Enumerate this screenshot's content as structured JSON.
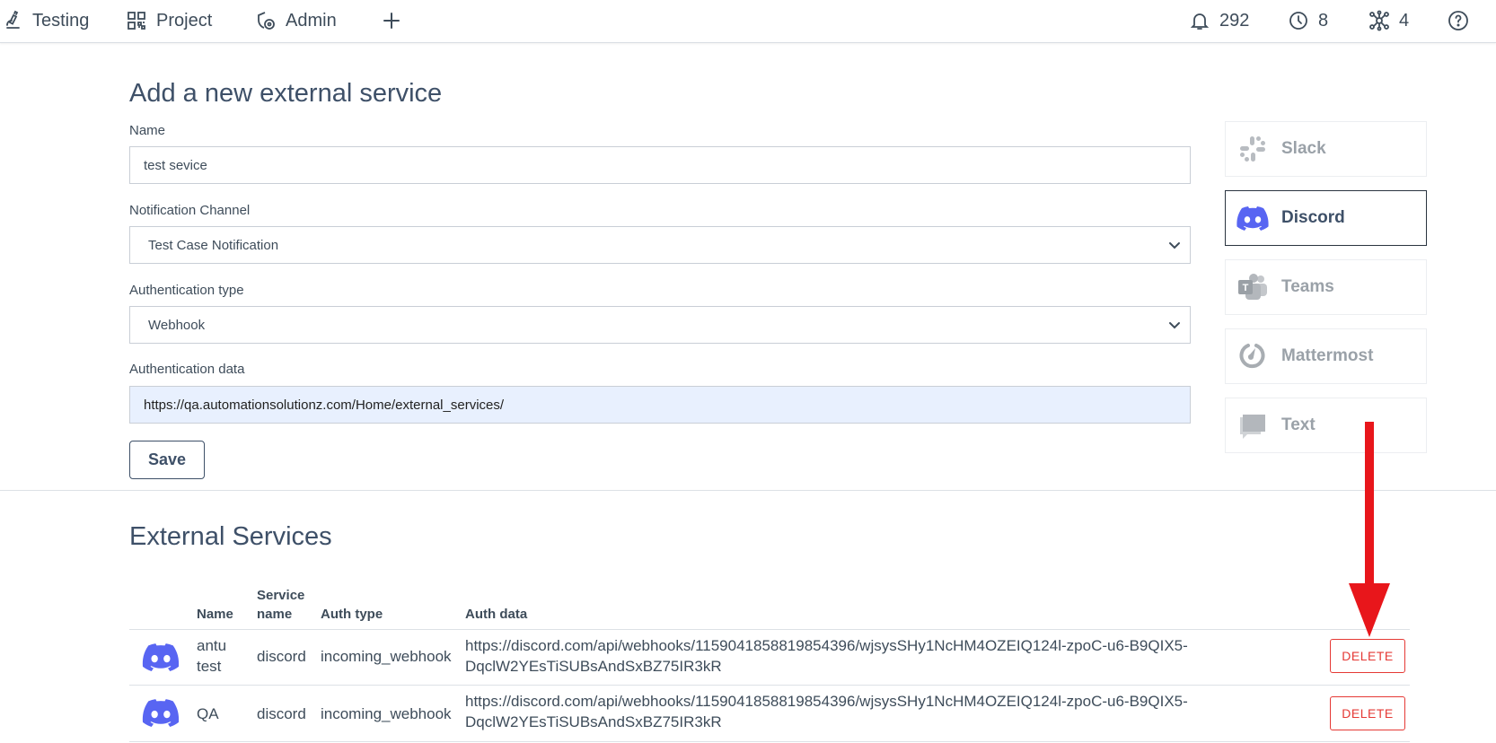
{
  "nav": {
    "testing": "Testing",
    "project": "Project",
    "admin": "Admin",
    "notifications_count": "292",
    "history_count": "8",
    "integrations_count": "4"
  },
  "form": {
    "title": "Add a new external service",
    "name_label": "Name",
    "name_value": "test sevice",
    "channel_label": "Notification Channel",
    "channel_value": "Test Case Notification",
    "auth_type_label": "Authentication type",
    "auth_type_value": "Webhook",
    "auth_data_label": "Authentication data",
    "auth_data_value": "https://qa.automationsolutionz.com/Home/external_services/",
    "save_label": "Save"
  },
  "providers": [
    {
      "label": "Slack",
      "active": false
    },
    {
      "label": "Discord",
      "active": true
    },
    {
      "label": "Teams",
      "active": false
    },
    {
      "label": "Mattermost",
      "active": false
    },
    {
      "label": "Text",
      "active": false
    }
  ],
  "services": {
    "title": "External Services",
    "headers": {
      "name": "Name",
      "service_name_1": "Service",
      "service_name_2": "name",
      "auth_type": "Auth type",
      "auth_data": "Auth data"
    },
    "rows": [
      {
        "name_1": "antu",
        "name_2": "test",
        "service": "discord",
        "auth_type": "incoming_webhook",
        "auth_data_1": "https://discord.com/api/webhooks/1159041858819854396/wjsysSHy1NcHM4OZEIQ124l-zpoC-u6-B9QIX5-",
        "auth_data_2": "DqclW2YEsTiSUBsAndSxBZ75IR3kR",
        "delete_label": "DELETE"
      },
      {
        "name_1": "QA",
        "name_2": "",
        "service": "discord",
        "auth_type": "incoming_webhook",
        "auth_data_1": "https://discord.com/api/webhooks/1159041858819854396/wjsysSHy1NcHM4OZEIQ124l-zpoC-u6-B9QIX5-",
        "auth_data_2": "DqclW2YEsTiSUBsAndSxBZ75IR3kR",
        "delete_label": "DELETE"
      }
    ]
  },
  "colors": {
    "discord": "#5865F2",
    "delete": "#e53935",
    "annotation_arrow": "#e8161b"
  },
  "icons": {
    "testing": "microscope-icon",
    "project": "qr-grid-icon",
    "admin": "shield-gear-icon",
    "add": "plus-icon",
    "notifications": "bell-icon",
    "history": "clock-icon",
    "integrations": "network-icon",
    "help": "help-circle-icon"
  }
}
